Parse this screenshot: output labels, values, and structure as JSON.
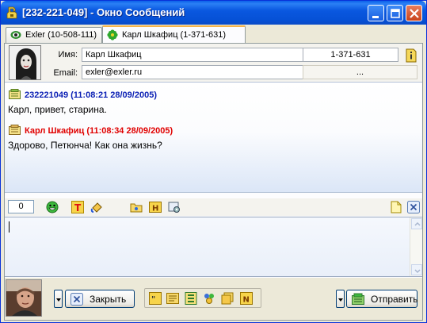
{
  "window": {
    "title": "[232-221-049] - Окно Сообщений",
    "icons": [
      "app-icon",
      "minimize-icon",
      "maximize-icon",
      "close-icon"
    ]
  },
  "tabs": [
    {
      "label": "Exler (10-508-111)",
      "icon": "eye-icon",
      "active": false
    },
    {
      "label": "Карл Шкафиц (1-371-631)",
      "icon": "flower-icon",
      "active": true
    }
  ],
  "contact": {
    "name_label": "Имя:",
    "name_value": "Карл  Шкафиц",
    "uin": "1-371-631",
    "email_label": "Email:",
    "email_value": "exler@exler.ru",
    "extra": "..."
  },
  "messages": [
    {
      "header": "232221049 (11:08:21 28/09/2005)",
      "text": "Карл, привет, старина.",
      "color": "#0a1fb4"
    },
    {
      "header": "Карл Шкафиц (11:08:34 28/09/2005)",
      "text": "Здорово, Петюнча! Как она жизнь?",
      "color": "#e00000"
    }
  ],
  "toolbar": {
    "counter": "0",
    "icons": [
      "smiley-icon",
      "text-color-icon",
      "bg-color-icon",
      "folder-icon",
      "history-icon",
      "settings-icon",
      "note-icon",
      "close-small-icon"
    ]
  },
  "input": {
    "value": ""
  },
  "bottom": {
    "close_label": "Закрыть",
    "send_label": "Отправить",
    "quick_icons": [
      "quote-icon",
      "template-icon",
      "list-icon",
      "contacts-icon",
      "book-icon",
      "note-n-icon"
    ]
  }
}
